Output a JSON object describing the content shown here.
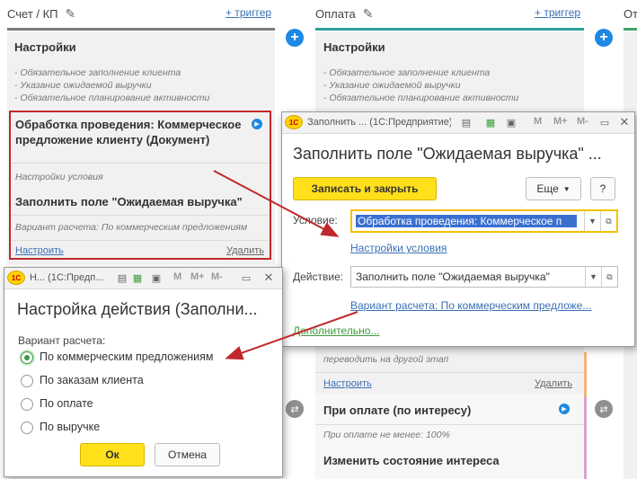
{
  "board": {
    "columns": [
      {
        "title": "Счет / КП",
        "trigger_label": "+ триггер",
        "accent": "#7a7a7a"
      },
      {
        "title": "Оплата",
        "trigger_label": "+ триггер",
        "accent": "#2fa09a"
      },
      {
        "title": "От",
        "accent": "#46a06a"
      }
    ],
    "stage1": {
      "settings_title": "Настройки",
      "settings_notes": [
        "- Обязательное заполнение клиента",
        "- Указание ожидаемой выручки",
        "- Обязательное планирование активности"
      ],
      "event_title": "Обработка проведения: Коммерческое предложение клиенту (Документ)",
      "condition_note": "Настройки условия",
      "action_title": "Заполнить  поле \"Ожидаемая  выручка\"",
      "action_note": "Вариант расчета: По коммерческим предложениям",
      "configure_link": "Настроить",
      "delete_link": "Удалить"
    },
    "stage2": {
      "settings_title": "Настройки",
      "settings_notes": [
        "- Обязательное заполнение клиента",
        "- Указание ожидаемой выручки",
        "- Обязательное планирование активности"
      ],
      "move_note": "переводить на другой этап",
      "configure_link": "Настроить",
      "delete_link": "Удалить",
      "event2_title": "При оплате (по интересу)",
      "event2_note": "При оплате не менее: 100%",
      "action2_title": "Изменить состояние интереса"
    }
  },
  "dialog_fill": {
    "titlebar_text": "Заполнить ...  (1С:Предприятие)",
    "heading": "Заполнить  поле \"Ожидаемая  выручка\"  ...",
    "save_close_label": "Записать и закрыть",
    "more_label": "Еще",
    "help_label": "?",
    "condition_label": "Условие:",
    "condition_value": "Обработка проведения: Коммерческое п",
    "condition_settings_link": "Настройки условия",
    "action_label": "Действие:",
    "action_value": "Заполнить  поле \"Ожидаемая  выручка\"",
    "calc_variant_link": "Вариант расчета: По коммерческим предложе...",
    "more_link": "Дополнительно..."
  },
  "dialog_action": {
    "titlebar_text": "Н...  (1С:Предп...",
    "heading": "Настройка действия (Заполни...",
    "group_label": "Вариант расчета:",
    "options": [
      {
        "label": "По коммерческим предложениям",
        "selected": true
      },
      {
        "label": "По заказам клиента",
        "selected": false
      },
      {
        "label": "По оплате",
        "selected": false
      },
      {
        "label": "По выручке",
        "selected": false
      }
    ],
    "ok_label": "Ок",
    "cancel_label": "Отмена"
  },
  "colors": {
    "accent_red": "#c0292b",
    "link_blue": "#3a6fb6",
    "button_yellow": "#ffe01b"
  },
  "icons": [
    "pencil-icon",
    "plus-icon",
    "move-icon",
    "play-icon",
    "logo-1c-icon",
    "document-icon",
    "calculator-icon",
    "calendar-icon",
    "restore-icon",
    "close-icon",
    "dropdown-icon",
    "open-icon",
    "chevron-down-icon"
  ]
}
